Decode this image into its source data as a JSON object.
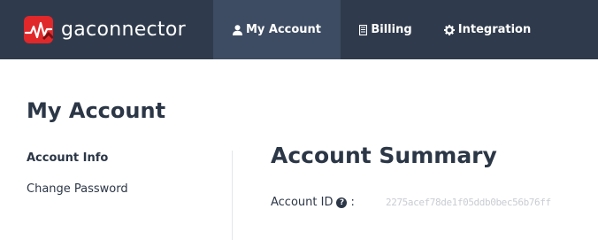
{
  "brand": {
    "name": "gaconnector",
    "logo_icon": "heartbeat-logo-icon",
    "logo_color": "#e0272a"
  },
  "nav": {
    "tabs": [
      {
        "label": "My Account",
        "icon": "user-icon",
        "active": true
      },
      {
        "label": "Billing",
        "icon": "receipt-icon",
        "active": false
      },
      {
        "label": "Integration",
        "icon": "gear-icon",
        "active": false
      }
    ],
    "bg_color": "#2f3b4c",
    "active_color": "#3d4c62"
  },
  "page": {
    "title": "My Account"
  },
  "sidebar": {
    "items": [
      {
        "label": "Account Info",
        "active": true
      },
      {
        "label": "Change Password",
        "active": false
      }
    ]
  },
  "summary": {
    "title": "Account Summary",
    "account_id_label": "Account ID",
    "separator": ":",
    "account_id_value": "2275acef78de1f05ddb0bec56b76ff"
  }
}
